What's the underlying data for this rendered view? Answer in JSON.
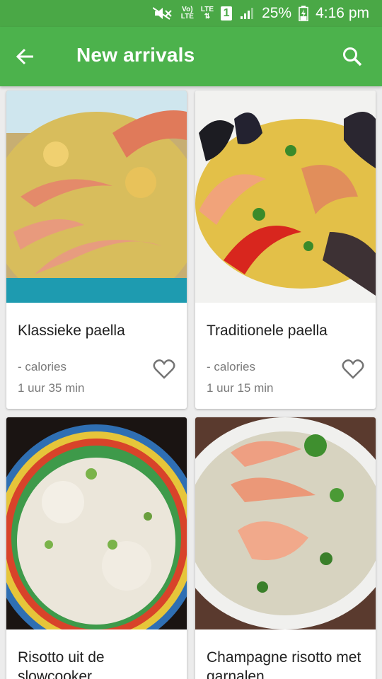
{
  "status_bar": {
    "signal_text_top": "Vo)",
    "signal_text_bottom": "LTE",
    "lte_label": "LTE",
    "sim_slot": "1",
    "battery": "25%",
    "time": "4:16 pm",
    "icons": [
      "mute-icon",
      "volte-icon",
      "lte-icon",
      "sim-1-icon",
      "signal-icon",
      "battery-icon"
    ]
  },
  "appbar": {
    "title": "New arrivals",
    "back_icon": "arrow-left-icon",
    "search_icon": "search-icon",
    "color": "#4cb24c"
  },
  "recipes": [
    {
      "name": "Klassieke paella",
      "calories": "- calories",
      "time": "1 uur 35 min"
    },
    {
      "name": "Traditionele paella",
      "calories": "- calories",
      "time": "1 uur 15 min"
    },
    {
      "name": "Risotto uit de slowcooker",
      "calories": "",
      "time": ""
    },
    {
      "name": "Champagne risotto met garnalen",
      "calories": "",
      "time": ""
    }
  ]
}
